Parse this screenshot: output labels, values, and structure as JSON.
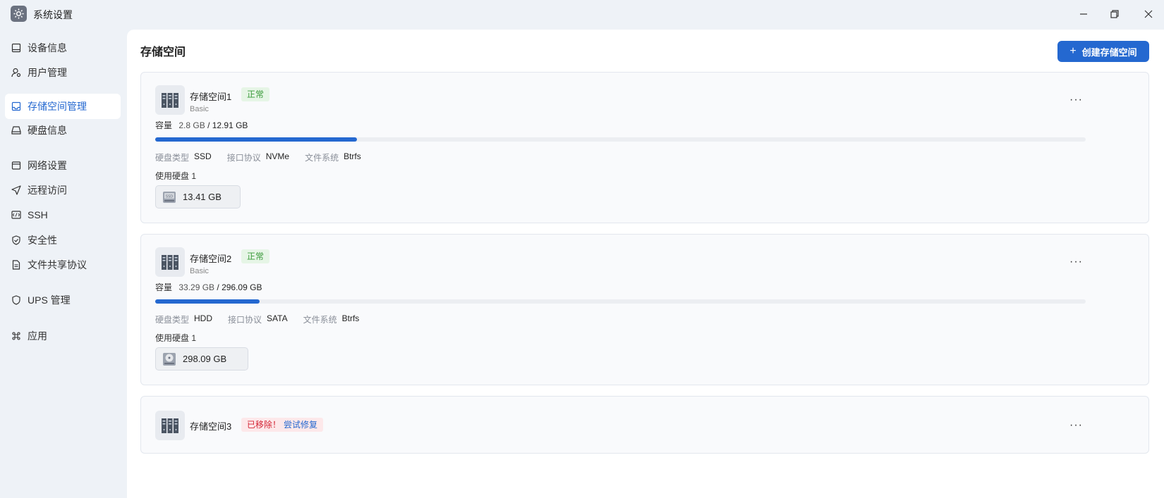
{
  "window": {
    "title": "系统设置",
    "controls": [
      "minimize",
      "maximize",
      "close"
    ]
  },
  "sidebar": {
    "items": [
      {
        "label": "设备信息",
        "icon": "device-icon"
      },
      {
        "label": "用户管理",
        "icon": "user-icon"
      },
      {
        "label": "存储空间管理",
        "icon": "storage-icon",
        "active": true
      },
      {
        "label": "硬盘信息",
        "icon": "disk-icon"
      },
      {
        "label": "网络设置",
        "icon": "network-icon"
      },
      {
        "label": "远程访问",
        "icon": "send-icon"
      },
      {
        "label": "SSH",
        "icon": "code-icon"
      },
      {
        "label": "安全性",
        "icon": "shield-check-icon"
      },
      {
        "label": "文件共享协议",
        "icon": "file-icon"
      },
      {
        "label": "UPS 管理",
        "icon": "shield-icon"
      },
      {
        "label": "应用",
        "icon": "command-icon"
      }
    ]
  },
  "main": {
    "title": "存储空间",
    "create_button": "创建存储空间",
    "create_icon": "+",
    "pools": [
      {
        "name": "存储空间1",
        "status": "正常",
        "type": "Basic",
        "capacity_label": "容量",
        "used": "2.8 GB",
        "total": "/ 12.91 GB",
        "usage_fraction": 0.217,
        "disk_type_label": "硬盘类型",
        "disk_type": "SSD",
        "protocol_label": "接口协议",
        "protocol": "NVMe",
        "fs_label": "文件系统",
        "fs": "Btrfs",
        "disks_used": "使用硬盘 1",
        "disk_size": "13.41 GB",
        "disk_icon": "ssd-icon"
      },
      {
        "name": "存储空间2",
        "status": "正常",
        "type": "Basic",
        "capacity_label": "容量",
        "used": "33.29 GB",
        "total": "/ 296.09 GB",
        "usage_fraction": 0.112,
        "disk_type_label": "硬盘类型",
        "disk_type": "HDD",
        "protocol_label": "接口协议",
        "protocol": "SATA",
        "fs_label": "文件系统",
        "fs": "Btrfs",
        "disks_used": "使用硬盘 1",
        "disk_size": "298.09 GB",
        "disk_icon": "hdd-icon"
      },
      {
        "name": "存储空间3",
        "status": "已移除！",
        "repair": "尝试修复"
      }
    ]
  },
  "colors": {
    "accent": "#2468d0",
    "ok": "#3a9a3a",
    "error": "#d32535"
  }
}
